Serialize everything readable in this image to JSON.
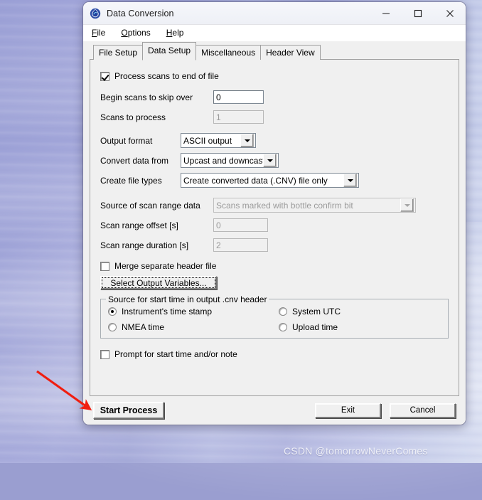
{
  "window": {
    "title": "Data Conversion",
    "icon": "seabird-droplet-icon",
    "controls": {
      "minimize": "minimize-icon",
      "maximize": "maximize-icon",
      "close": "close-icon"
    }
  },
  "menu": {
    "items": [
      {
        "label": "File",
        "accel": "F"
      },
      {
        "label": "Options",
        "accel": "O"
      },
      {
        "label": "Help",
        "accel": "H"
      }
    ]
  },
  "tabs": [
    {
      "label": "File Setup",
      "active": false
    },
    {
      "label": "Data Setup",
      "active": true
    },
    {
      "label": "Miscellaneous",
      "active": false
    },
    {
      "label": "Header View",
      "active": false
    }
  ],
  "form": {
    "process_to_end": {
      "label": "Process scans to end of file",
      "checked": true
    },
    "begin_skip": {
      "label": "Begin scans to skip over",
      "value": "0",
      "disabled": false
    },
    "scans_to_process": {
      "label": "Scans to process",
      "value": "1",
      "disabled": true
    },
    "output_format": {
      "label": "Output format",
      "value": "ASCII output",
      "disabled": false
    },
    "convert_from": {
      "label": "Convert data from",
      "value": "Upcast and downcast",
      "disabled": false
    },
    "create_file_types": {
      "label": "Create file types",
      "value": "Create converted data (.CNV) file only",
      "disabled": false
    },
    "scan_range_source": {
      "label": "Source of scan range data",
      "value": "Scans marked with bottle confirm bit",
      "disabled": true
    },
    "scan_range_offset": {
      "label": "Scan range offset [s]",
      "value": "0",
      "disabled": true
    },
    "scan_range_duration": {
      "label": "Scan range duration [s]",
      "value": "2",
      "disabled": true
    },
    "merge_header": {
      "label": "Merge separate header file",
      "checked": false
    },
    "select_output_variables": {
      "label": "Select Output Variables..."
    },
    "prompt_start_time": {
      "label": "Prompt for start time and/or note",
      "checked": false
    }
  },
  "start_time_group": {
    "title": "Source for start time in output .cnv header",
    "options": [
      {
        "label": "Instrument's time stamp",
        "selected": true
      },
      {
        "label": "System UTC",
        "selected": false
      },
      {
        "label": "NMEA time",
        "selected": false
      },
      {
        "label": "Upload time",
        "selected": false
      }
    ]
  },
  "footer": {
    "start_process": "Start Process",
    "exit": "Exit",
    "cancel": "Cancel"
  },
  "annotation": {
    "arrow_color": "#f01e10"
  },
  "watermark": {
    "text": "CSDN @tomorrowNeverComes"
  }
}
